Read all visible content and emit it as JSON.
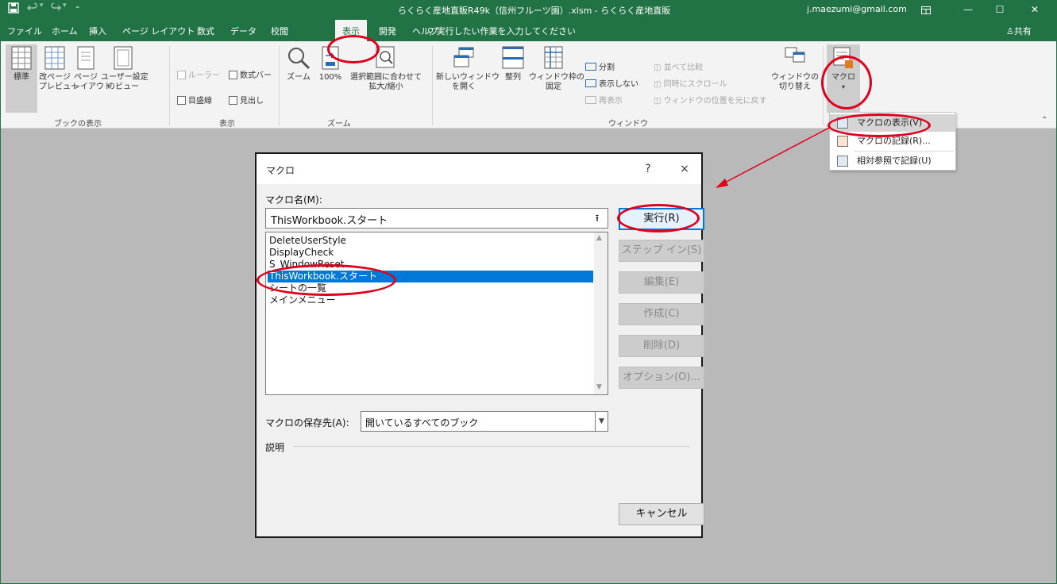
{
  "titlebar": {
    "title": "らくらく産地直販R49k（信州フルーツ園）.xlsm  -  らくらく産地直販",
    "account": "j.maezumi@gmail.com",
    "save_icon": "save-icon",
    "undo_icon": "undo-icon",
    "redo_icon": "redo-icon",
    "qat_icon": "customize-icon"
  },
  "tabs": {
    "items": [
      "ファイル",
      "ホーム",
      "挿入",
      "ページ レイアウト",
      "数式",
      "データ",
      "校閲",
      "表示",
      "開発",
      "ヘルプ"
    ],
    "tell_me": "実行したい作業を入力してください",
    "share": "共有"
  },
  "ribbon": {
    "views": {
      "normal": "標準",
      "page_break": "改ページ\nプレビュー",
      "page_layout": "ページ\nレイアウト",
      "custom": "ユーザー設定\nのビュー",
      "group": "ブックの表示"
    },
    "show": {
      "ruler": "ルーラー",
      "formula_bar": "数式バー",
      "gridlines": "目盛線",
      "headings": "見出し",
      "group": "表示"
    },
    "zoom": {
      "zoom": "ズーム",
      "zoom100": "100%",
      "zoom_sel": "選択範囲に合わせて\n拡大/縮小",
      "group": "ズーム"
    },
    "window": {
      "new_window": "新しいウィンドウ\nを開く",
      "arrange": "整列",
      "freeze": "ウィンドウ枠の\n固定",
      "split": "分割",
      "hide": "表示しない",
      "unhide": "再表示",
      "side_by_side": "並べて比較",
      "sync_scroll": "同時にスクロール",
      "reset_pos": "ウィンドウの位置を元に戻す",
      "switch": "ウィンドウの\n切り替え",
      "group": "ウィンドウ"
    },
    "macros": {
      "label": "マクロ"
    }
  },
  "macro_menu": {
    "items": [
      "マクロの表示(V)",
      "マクロの記録(R)...",
      "相対参照で記録(U)"
    ]
  },
  "dialog": {
    "title": "マクロ",
    "help": "?",
    "close": "×",
    "name_label": "マクロ名(M):",
    "name_value": "ThisWorkbook.スタート",
    "list": [
      "DeleteUserStyle",
      "DisplayCheck",
      "S_WindowReset",
      "ThisWorkbook.スタート",
      "シートの一覧",
      "メインメニュー"
    ],
    "selected_index": 3,
    "buttons": {
      "run": "実行(R)",
      "step": "ステップ イン(S)",
      "edit": "編集(E)",
      "create": "作成(C)",
      "delete": "削除(D)",
      "options": "オプション(O)..."
    },
    "store_label": "マクロの保存先(A):",
    "store_value": "開いているすべてのブック",
    "description_label": "説明",
    "cancel": "キャンセル"
  },
  "colors": {
    "excel_green": "#217346",
    "annotation_red": "#e0001c",
    "selection_blue": "#0078d7"
  }
}
